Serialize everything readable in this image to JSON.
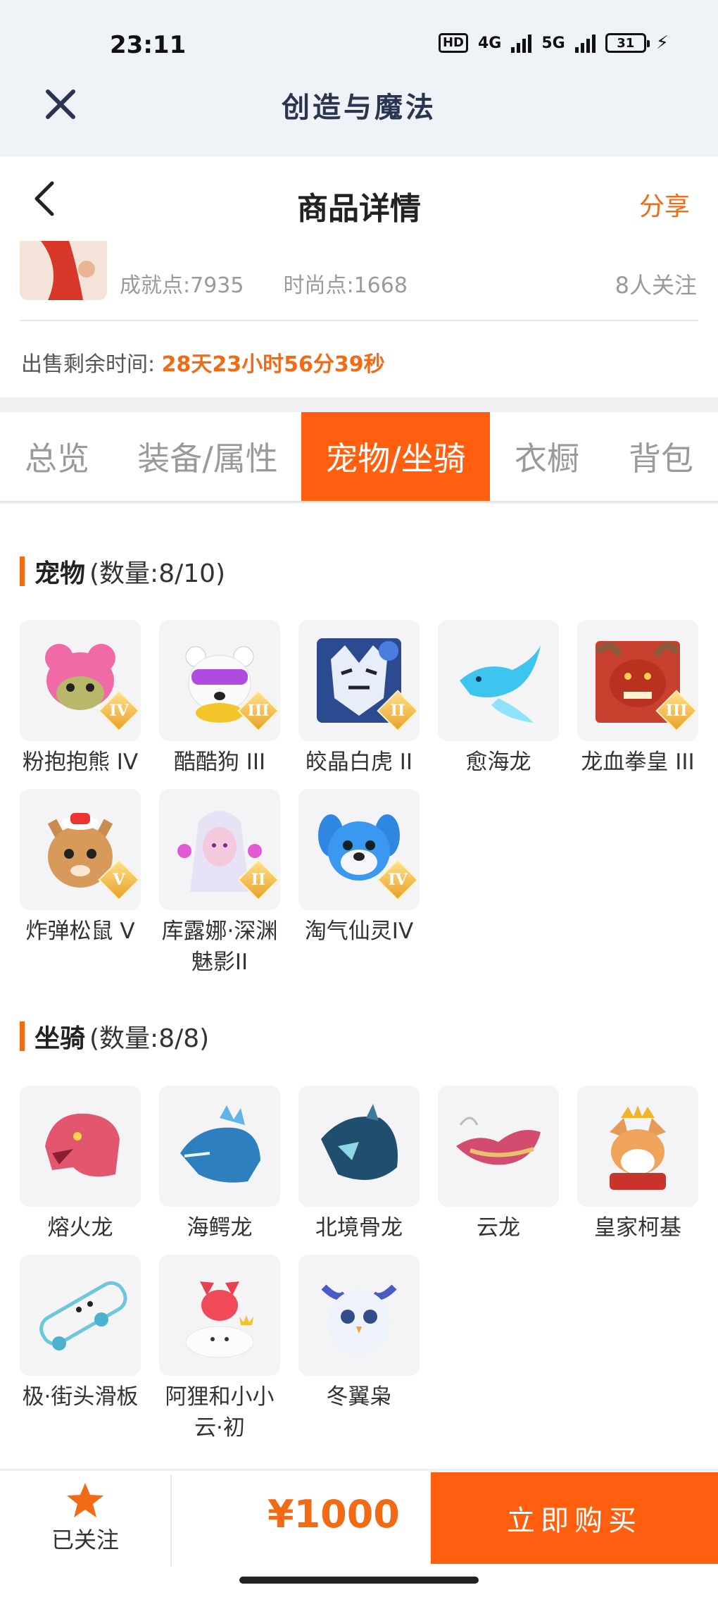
{
  "status": {
    "time": "23:11",
    "hd": "HD",
    "net1": "4G",
    "net2": "5G",
    "battery": "31"
  },
  "app": {
    "title": "创造与魔法"
  },
  "header": {
    "title": "商品详情",
    "share": "分享"
  },
  "info": {
    "achievement": "成就点:7935",
    "fashion": "时尚点:1668",
    "followers": "8人关注",
    "timer_label": "出售剩余时间:",
    "timer_value": "28天23小时56分39秒"
  },
  "tabs": [
    {
      "label": "总览"
    },
    {
      "label": "装备/属性"
    },
    {
      "label": "宠物/坐骑",
      "active": true
    },
    {
      "label": "衣橱"
    },
    {
      "label": "背包"
    }
  ],
  "pets": {
    "title": "宠物",
    "count": "(数量:8/10)",
    "items": [
      {
        "name": "粉抱抱熊 IV",
        "rank": "IV",
        "icon": "pink-bear-icon"
      },
      {
        "name": "酷酷狗 III",
        "rank": "III",
        "icon": "cool-dog-icon"
      },
      {
        "name": "皎晶白虎 II",
        "rank": "II",
        "icon": "white-tiger-icon"
      },
      {
        "name": "愈海龙",
        "rank": "",
        "icon": "sea-dragon-icon"
      },
      {
        "name": "龙血拳皇 III",
        "rank": "III",
        "icon": "dragon-blood-boxer-icon"
      },
      {
        "name": "炸弹松鼠 V",
        "rank": "V",
        "icon": "bomb-squirrel-icon"
      },
      {
        "name": "库露娜·深渊魅影II",
        "rank": "II",
        "icon": "kuluna-abyss-icon"
      },
      {
        "name": "淘气仙灵IV",
        "rank": "IV",
        "icon": "naughty-fairy-icon"
      }
    ]
  },
  "mounts": {
    "title": "坐骑",
    "count": "(数量:8/8)",
    "items": [
      {
        "name": "熔火龙",
        "icon": "molten-dragon-icon"
      },
      {
        "name": "海鳄龙",
        "icon": "sea-croc-dragon-icon"
      },
      {
        "name": "北境骨龙",
        "icon": "north-bone-dragon-icon"
      },
      {
        "name": "云龙",
        "icon": "cloud-dragon-icon"
      },
      {
        "name": "皇家柯基",
        "icon": "royal-corgi-icon"
      },
      {
        "name": "极·街头滑板",
        "icon": "skateboard-icon"
      },
      {
        "name": "阿狸和小小云·初",
        "icon": "ahri-cloud-icon"
      },
      {
        "name": "冬翼枭",
        "icon": "winter-owl-icon"
      }
    ]
  },
  "bottom": {
    "follow_label": "已关注",
    "price": "¥1000",
    "buy_label": "立即购买"
  },
  "colors": {
    "accent": "#ff5f0f",
    "text_accent": "#f26a14",
    "rank_gold": "#e8a22a"
  }
}
